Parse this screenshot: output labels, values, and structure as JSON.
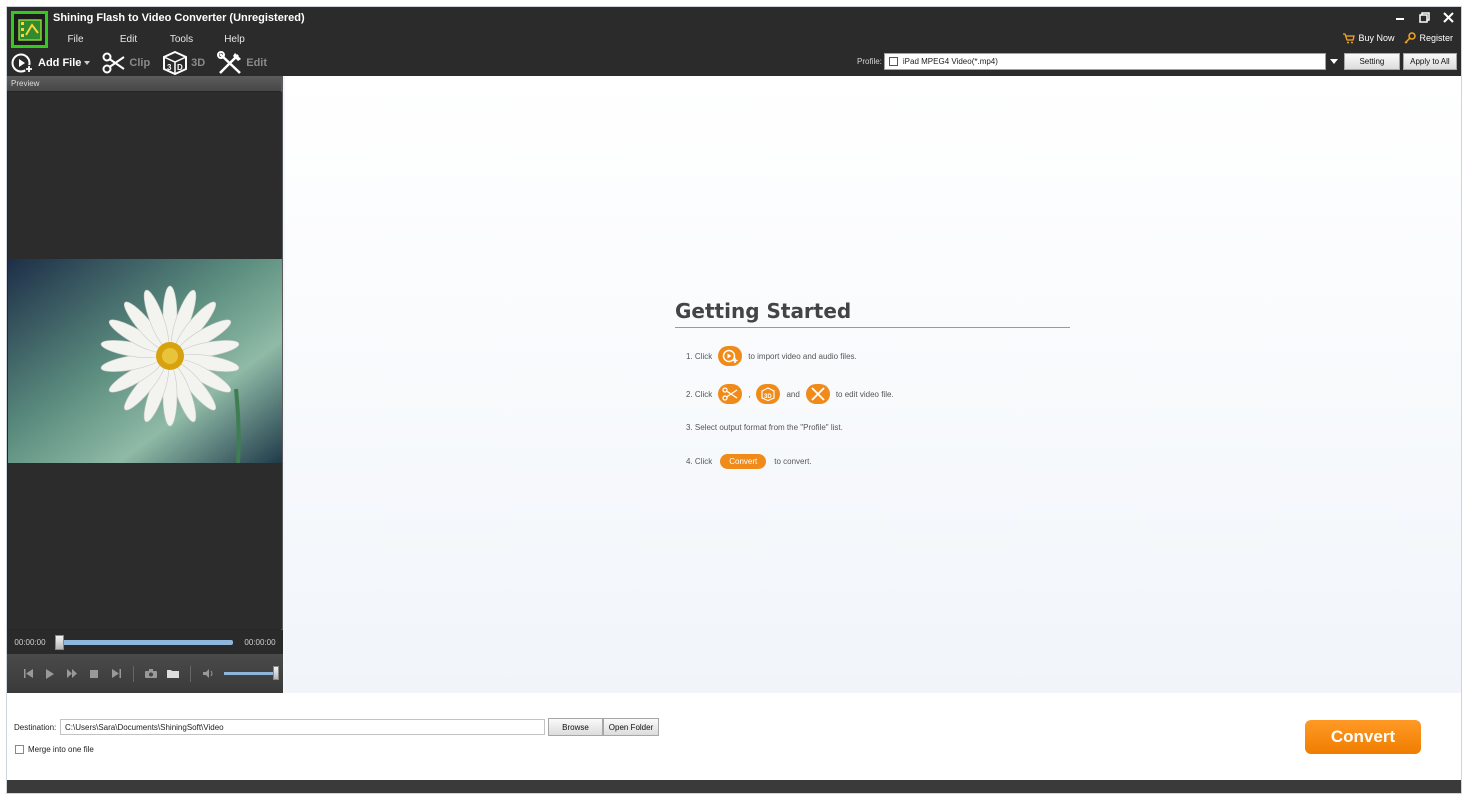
{
  "window": {
    "title": "Shining Flash to Video Converter (Unregistered)",
    "controls": [
      "minimize-icon",
      "restore-icon",
      "close-icon"
    ]
  },
  "menu": [
    "File",
    "Edit",
    "Tools",
    "Help"
  ],
  "top_links": {
    "buy_now": "Buy Now",
    "register": "Register"
  },
  "toolbar": {
    "add_file": "Add File",
    "clip": "Clip",
    "three_d": "3D",
    "edit": "Edit"
  },
  "profile": {
    "label": "Profile:",
    "value": "iPad MPEG4 Video(*.mp4)",
    "setting": "Setting",
    "apply_to_all": "Apply to All"
  },
  "preview": {
    "header": "Preview",
    "time_current": "00:00:00",
    "time_total": "00:00:00",
    "progress": 0,
    "volume": 1
  },
  "getting_started": {
    "title": "Getting Started",
    "step1_prefix": "1. Click",
    "step1_suffix": "to import video and audio files.",
    "step2_prefix": "2. Click",
    "step2_comma": ",",
    "step2_and": "and",
    "step2_suffix": "to edit video file.",
    "step3": "3. Select output format from the \"Profile\" list.",
    "step4_prefix": "4. Click",
    "step4_button": "Convert",
    "step4_suffix": "to convert."
  },
  "bottom": {
    "destination_label": "Destination:",
    "destination_value": "C:\\Users\\Sara\\Documents\\ShiningSoft\\Video",
    "browse": "Browse",
    "open_folder": "Open Folder",
    "merge_label": "Merge into one file",
    "convert": "Convert"
  },
  "colors": {
    "accent": "#f08b1a",
    "logo_border": "#35c81f",
    "titlebar": "#2b2b2b"
  }
}
